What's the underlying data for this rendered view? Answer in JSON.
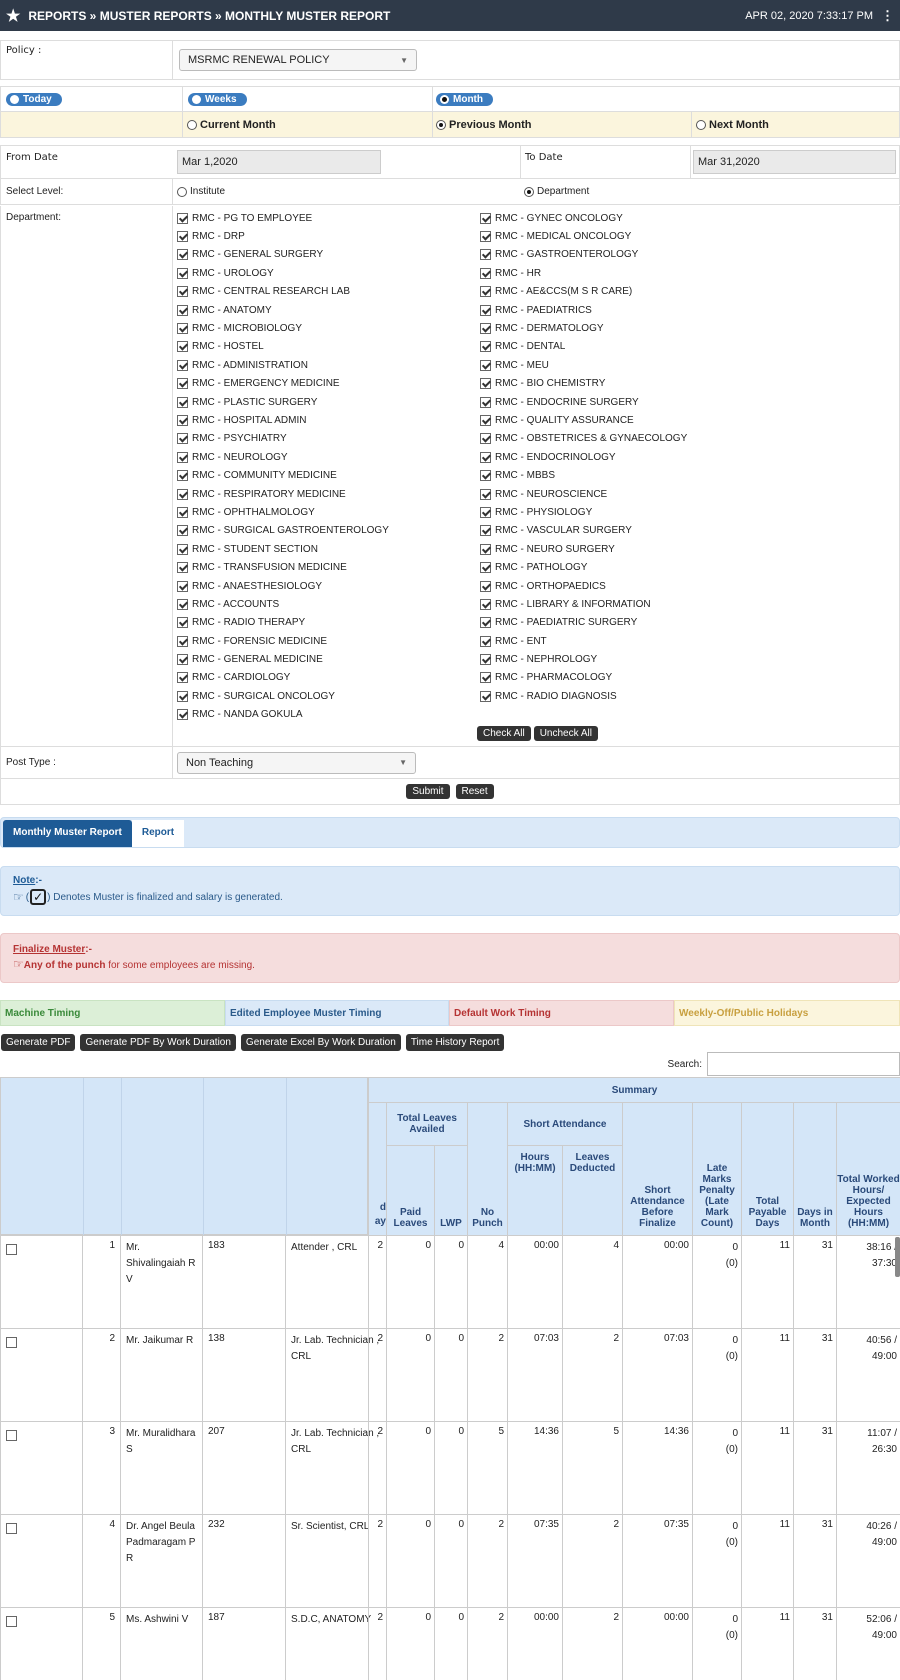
{
  "header": {
    "breadcrumb": "REPORTS » MUSTER REPORTS » MONTHLY MUSTER REPORT",
    "datetime": "APR 02, 2020  7:33:17 PM"
  },
  "policy": {
    "label": "Policy :",
    "value": "MSRMC RENEWAL POLICY"
  },
  "range": {
    "today": "Today",
    "weeks": "Weeks",
    "month": "Month",
    "current": "Current Month",
    "previous": "Previous Month",
    "next": "Next Month"
  },
  "dates": {
    "from_label": "From Date",
    "from_value": "Mar 1,2020",
    "to_label": "To Date",
    "to_value": "Mar 31,2020"
  },
  "level": {
    "label": "Select Level:",
    "institute": "Institute",
    "department": "Department"
  },
  "department_label": "Department:",
  "depts_left": [
    "RMC - PG TO EMPLOYEE",
    "RMC - DRP",
    "RMC - GENERAL SURGERY",
    "RMC - UROLOGY",
    "RMC - CENTRAL RESEARCH LAB",
    "RMC - ANATOMY",
    "RMC - MICROBIOLOGY",
    "RMC - HOSTEL",
    "RMC - ADMINISTRATION",
    "RMC - EMERGENCY MEDICINE",
    "RMC - PLASTIC SURGERY",
    "RMC - HOSPITAL ADMIN",
    "RMC - PSYCHIATRY",
    "RMC - NEUROLOGY",
    "RMC - COMMUNITY MEDICINE",
    "RMC - RESPIRATORY MEDICINE",
    "RMC - OPHTHALMOLOGY",
    "RMC - SURGICAL GASTROENTEROLOGY",
    "RMC - STUDENT SECTION",
    "RMC - TRANSFUSION MEDICINE",
    "RMC - ANAESTHESIOLOGY",
    "RMC - ACCOUNTS",
    "RMC - RADIO THERAPY",
    "RMC - FORENSIC MEDICINE",
    "RMC - GENERAL MEDICINE",
    "RMC - CARDIOLOGY",
    "RMC - SURGICAL ONCOLOGY",
    "RMC - NANDA GOKULA"
  ],
  "depts_right": [
    "RMC - GYNEC ONCOLOGY",
    "RMC - MEDICAL ONCOLOGY",
    "RMC - GASTROENTEROLOGY",
    "RMC - HR",
    "RMC - AE&CCS(M S R CARE)",
    "RMC - PAEDIATRICS",
    "RMC - DERMATOLOGY",
    "RMC - DENTAL",
    "RMC - MEU",
    "RMC - BIO CHEMISTRY",
    "RMC - ENDOCRINE SURGERY",
    "RMC - QUALITY ASSURANCE",
    "RMC - OBSTETRICES & GYNAECOLOGY",
    "RMC - ENDOCRINOLOGY",
    "RMC - MBBS",
    "RMC - NEUROSCIENCE",
    "RMC - PHYSIOLOGY",
    "RMC - VASCULAR SURGERY",
    "RMC - NEURO SURGERY",
    "RMC - PATHOLOGY",
    "RMC - ORTHOPAEDICS",
    "RMC - LIBRARY & INFORMATION",
    "RMC - PAEDIATRIC SURGERY",
    "RMC - ENT",
    "RMC - NEPHROLOGY",
    "RMC - PHARMACOLOGY",
    "RMC - RADIO DIAGNOSIS"
  ],
  "check_all": "Check All",
  "uncheck_all": "Uncheck All",
  "post": {
    "label": "Post Type :",
    "value": "Non Teaching"
  },
  "submit": "Submit",
  "reset": "Reset",
  "tabs": {
    "monthly": "Monthly Muster Report",
    "report": "Report"
  },
  "note": {
    "title": "Note",
    "suffix": ":-",
    "open": "(",
    "text": ") Denotes Muster is finalized and salary is generated."
  },
  "finalize": {
    "title": "Finalize Muster",
    "suffix": ":-",
    "bold": "Any of the punch",
    "text": " for some employees are missing."
  },
  "legend": {
    "machine": "Machine Timing",
    "edited": "Edited Employee Muster Timing",
    "default": "Default Work Timing",
    "weekly": "Weekly-Off/Public Holidays"
  },
  "actions": {
    "pdf": "Generate PDF",
    "pdf_dur": "Generate PDF By Work Duration",
    "excel_dur": "Generate Excel By Work Duration",
    "history": "Time History Report"
  },
  "search_label": "Search:",
  "table": {
    "summary": "Summary",
    "total_leaves": "Total Leaves Availed",
    "short_att": "Short Attendance",
    "day_frag": "d\nay",
    "paid": "Paid Leaves",
    "lwp": "LWP",
    "no_punch": "No Punch",
    "hours": "Hours (HH:MM)",
    "leaves_ded": "Leaves Deducted",
    "short_before": "Short Attendance Before Finalize",
    "late": "Late Marks Penalty (Late Mark Count)",
    "payable": "Total Payable Days",
    "days": "Days in Month",
    "worked": "Total Worked Hours/ Expected Hours (HH:MM)"
  },
  "rows": [
    {
      "sl": "1",
      "name": "Mr. Shivalingaiah R V",
      "id": "183",
      "desig": "Attender , CRL",
      "d": "2",
      "paid": "0",
      "lwp": "0",
      "np": "4",
      "hrs": "00:00",
      "ld": "4",
      "sb": "00:00",
      "late": "0",
      "latec": "(0)",
      "pay": "11",
      "dim": "31",
      "wh1": "38:16 /",
      "wh2": "37:30"
    },
    {
      "sl": "2",
      "name": "Mr. Jaikumar R",
      "id": "138",
      "desig": "Jr. Lab. Technician , CRL",
      "d": "2",
      "paid": "0",
      "lwp": "0",
      "np": "2",
      "hrs": "07:03",
      "ld": "2",
      "sb": "07:03",
      "late": "0",
      "latec": "(0)",
      "pay": "11",
      "dim": "31",
      "wh1": "40:56 /",
      "wh2": "49:00"
    },
    {
      "sl": "3",
      "name": "Mr. Muralidhara S",
      "id": "207",
      "desig": "Jr. Lab. Technician , CRL",
      "d": "2",
      "paid": "0",
      "lwp": "0",
      "np": "5",
      "hrs": "14:36",
      "ld": "5",
      "sb": "14:36",
      "late": "0",
      "latec": "(0)",
      "pay": "11",
      "dim": "31",
      "wh1": "11:07 /",
      "wh2": "26:30"
    },
    {
      "sl": "4",
      "name": "Dr. Angel Beula Padmaragam P R",
      "id": "232",
      "desig": "Sr. Scientist, CRL",
      "d": "2",
      "paid": "0",
      "lwp": "0",
      "np": "2",
      "hrs": "07:35",
      "ld": "2",
      "sb": "07:35",
      "late": "0",
      "latec": "(0)",
      "pay": "11",
      "dim": "31",
      "wh1": "40:26 /",
      "wh2": "49:00"
    },
    {
      "sl": "5",
      "name": "Ms. Ashwini V",
      "id": "187",
      "desig": "S.D.C, ANATOMY",
      "d": "2",
      "paid": "0",
      "lwp": "0",
      "np": "2",
      "hrs": "00:00",
      "ld": "2",
      "sb": "00:00",
      "late": "0",
      "latec": "(0)",
      "pay": "11",
      "dim": "31",
      "wh1": "52:06 /",
      "wh2": "49:00"
    }
  ]
}
